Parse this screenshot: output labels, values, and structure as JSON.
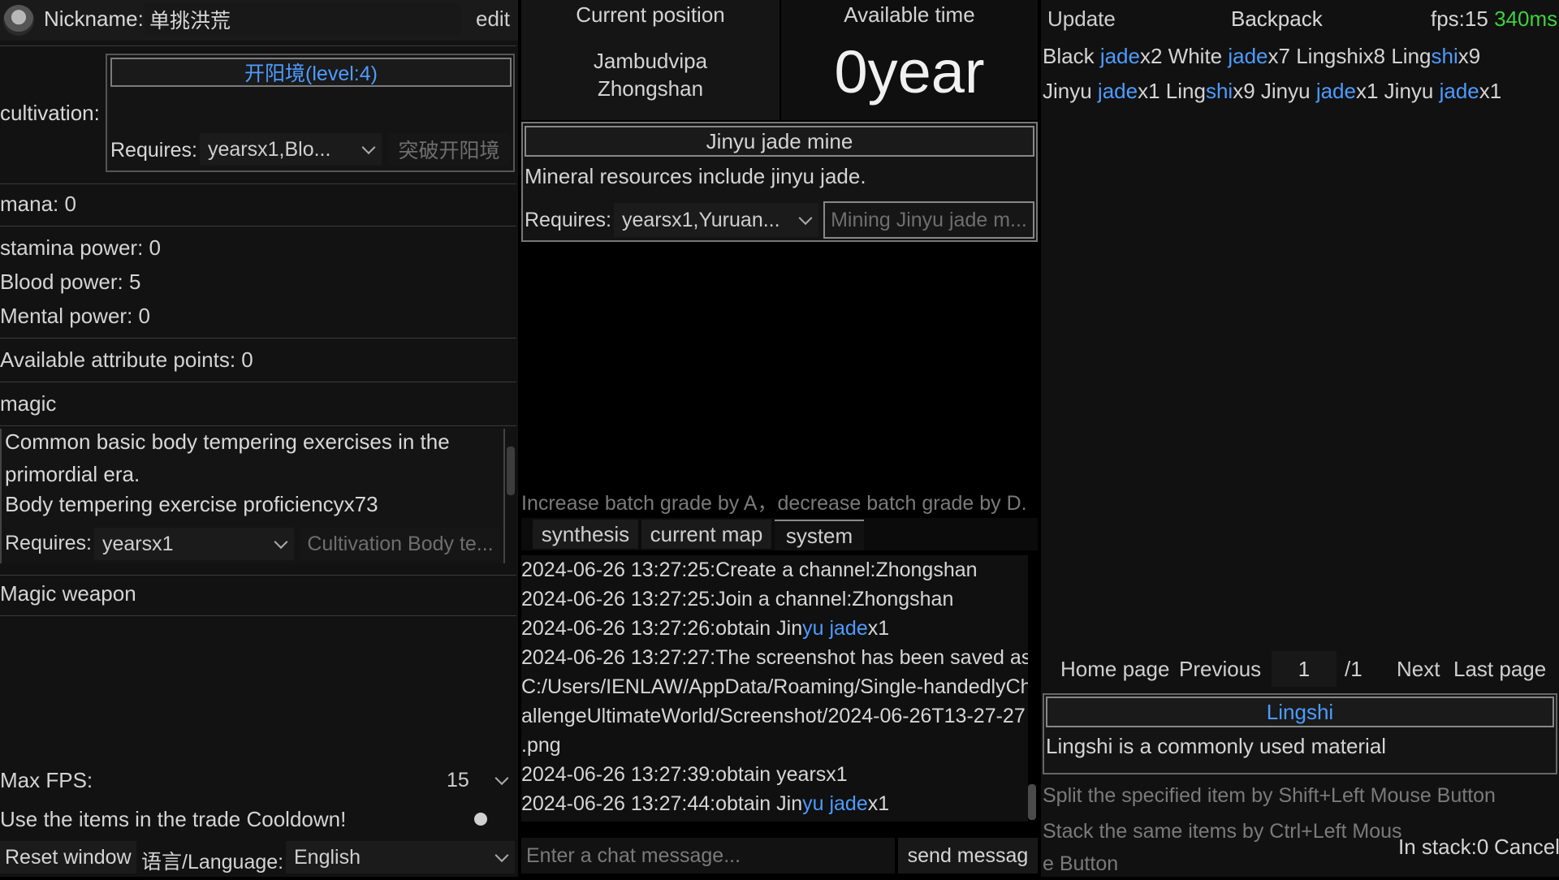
{
  "profile": {
    "nickname_label": "Nickname:",
    "nickname_value": "单挑洪荒",
    "edit_label": "edit",
    "icon": "avatar-icon"
  },
  "cultivation": {
    "label": "cultivation:",
    "realm": "开阳境(level:4)",
    "requires_label": "Requires:",
    "requires_value": "yearsx1,Blo...",
    "breakthrough_button": "突破开阳境"
  },
  "stats": {
    "mana": "mana: 0",
    "stamina": "stamina power: 0",
    "blood": "Blood power: 5",
    "mental": "Mental power: 0",
    "attribute_points": "Available attribute points: 0"
  },
  "magic": {
    "heading": "magic",
    "description_line1": "Common basic body tempering exercises in the",
    "description_line2": "primordial era.",
    "proficiency": "Body tempering exercise proficiencyx73",
    "requires_label": "Requires:",
    "requires_value": "yearsx1",
    "action_button": "Cultivation Body te..."
  },
  "magic_weapon": {
    "heading": "Magic weapon"
  },
  "settings": {
    "max_fps_label": "Max FPS:",
    "max_fps_value": "15",
    "trade_cooldown_label": "Use the items in the trade Cooldown!",
    "reset_window": "Reset window",
    "language_label": "语言/Language:",
    "language_value": "English"
  },
  "position": {
    "header": "Current position",
    "line1": "Jambudvipa",
    "line2": "Zhongshan"
  },
  "time": {
    "header": "Available time",
    "value": "0",
    "unit": "year"
  },
  "location_card": {
    "title": "Jinyu jade mine",
    "description": "Mineral resources include jinyu jade.",
    "requires_label": "Requires:",
    "requires_value": "yearsx1,Yuruan...",
    "action_button": "Mining Jinyu jade m..."
  },
  "hint": "Increase batch grade by A，decrease batch grade by D.",
  "tabs": {
    "synthesis": "synthesis",
    "current_map": "current map",
    "system": "system"
  },
  "log": {
    "l1": "2024-06-26 13:27:25:Create a channel:Zhongshan",
    "l2": "2024-06-26 13:27:25:Join a channel:Zhongshan",
    "l3a": "2024-06-26 13:27:26:obtain Jin",
    "l3b": "yu ",
    "l3c": "jade",
    "l3d": "x1",
    "l4": "2024-06-26 13:27:27:The screenshot has been saved as:",
    "l5": "C:/Users/IENLAW/AppData/Roaming/Single-handedlyCh",
    "l6": "allengeUltimateWorld/Screenshot/2024-06-26T13-27-27",
    "l7": ".png",
    "l8": "2024-06-26 13:27:39:obtain yearsx1",
    "l9a": "2024-06-26 13:27:44:obtain Jin",
    "l9b": "yu ",
    "l9c": "jade",
    "l9d": "x1"
  },
  "chat": {
    "placeholder": "Enter a chat message...",
    "send_button": "send messag"
  },
  "top_right": {
    "update": "Update",
    "backpack": "Backpack",
    "fps": "fps:15",
    "latency": "340ms"
  },
  "backpack": {
    "row1": [
      {
        "name_a": "Black ",
        "name_b": "jade",
        "qty": "x2"
      },
      {
        "name_a": "White ",
        "name_b": "jade",
        "qty": "x7"
      },
      {
        "name_a": "Lingshi",
        "name_b": "",
        "qty": "x8"
      },
      {
        "name_a": "Ling",
        "name_b": "shi",
        "qty": "x9"
      }
    ],
    "row2": [
      {
        "name_a": "Jinyu ",
        "name_b": "jade",
        "qty": "x1"
      },
      {
        "name_a": "Ling",
        "name_b": "shi",
        "qty": "x9"
      },
      {
        "name_a": "Jinyu ",
        "name_b": "jade",
        "qty": "x1"
      },
      {
        "name_a": "Jinyu ",
        "name_b": "jade",
        "qty": "x1"
      }
    ]
  },
  "pagination": {
    "home": "Home page",
    "previous": "Previous",
    "page": "1",
    "total": "/1",
    "next": "Next",
    "last": "Last page"
  },
  "item_detail": {
    "title_a": "Ling",
    "title_b": "shi",
    "description": "Lingshi is a commonly used material"
  },
  "help": {
    "split": "Split the specified item by Shift+Left Mouse Button",
    "stack_line1": "Stack the same items by Ctrl+Left Mous",
    "stack_line2": "e Button",
    "in_stack": "In stack:0",
    "cancel": "Cancel"
  },
  "colors": {
    "background": "#000000",
    "panel": "#151515",
    "link_blue": "#4d9bff",
    "latency_green": "#3ed13e"
  }
}
